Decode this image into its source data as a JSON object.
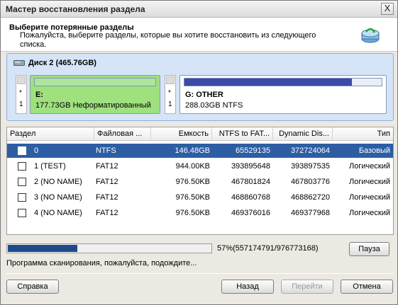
{
  "window": {
    "title": "Мастер восстановления раздела",
    "close_glyph": "X"
  },
  "header": {
    "title": "Выберите потерянные разделы",
    "subtitle": "Пожалуйста, выберите разделы, которые вы хотите восстановить из следующего списка.",
    "icon": "recovery-wizard-icon"
  },
  "disk": {
    "label": "Диск 2 (465.76GB)",
    "icon": "disk-icon",
    "slots": [
      {
        "line1": "*",
        "line2": "1"
      },
      {
        "line1": "*",
        "line2": "1"
      }
    ],
    "partitions": [
      {
        "name": "E:",
        "info": "177.73GB Неформатированный",
        "color": "#9fe07f",
        "fill_color": "#aee6a0",
        "fill_fraction": 1.0
      },
      {
        "name": "G: OTHER",
        "info": "288.03GB NTFS",
        "color": "#ffffff",
        "fill_color": "#3c4aa8",
        "fill_fraction": 0.85
      }
    ]
  },
  "table": {
    "columns": [
      "Раздел",
      "Файловая ...",
      "Емкость",
      "NTFS to FAT...",
      "Dynamic Dis...",
      "Тип"
    ],
    "rows": [
      {
        "name": "0",
        "fs": "NTFS",
        "size": "146.48GB",
        "ntfs_fat": "65529135",
        "dynamic": "372724064",
        "type": "Базовый",
        "selected": true
      },
      {
        "name": "1 (TEST)",
        "fs": "FAT12",
        "size": "944.00KB",
        "ntfs_fat": "393895648",
        "dynamic": "393897535",
        "type": "Логический",
        "selected": false
      },
      {
        "name": "2 (NO NAME)",
        "fs": "FAT12",
        "size": "976.50KB",
        "ntfs_fat": "467801824",
        "dynamic": "467803776",
        "type": "Логический",
        "selected": false
      },
      {
        "name": "3 (NO NAME)",
        "fs": "FAT12",
        "size": "976.50KB",
        "ntfs_fat": "468860768",
        "dynamic": "468862720",
        "type": "Логический",
        "selected": false
      },
      {
        "name": "4 (NO NAME)",
        "fs": "FAT12",
        "size": "976.50KB",
        "ntfs_fat": "469376016",
        "dynamic": "469377968",
        "type": "Логический",
        "selected": false
      }
    ]
  },
  "progress": {
    "percent": 57,
    "text": "57%(557174791/976773168)",
    "status": "Программа сканирования, пожалуйста, подождите...",
    "pause_label": "Пауза",
    "fill_color": "#1e4a8c"
  },
  "footer": {
    "help_label": "Справка",
    "back_label": "Назад",
    "next_label": "Перейти",
    "cancel_label": "Отмена"
  },
  "colors": {
    "selection": "#2d5ea3",
    "disk_panel": "#d5e4f7"
  }
}
